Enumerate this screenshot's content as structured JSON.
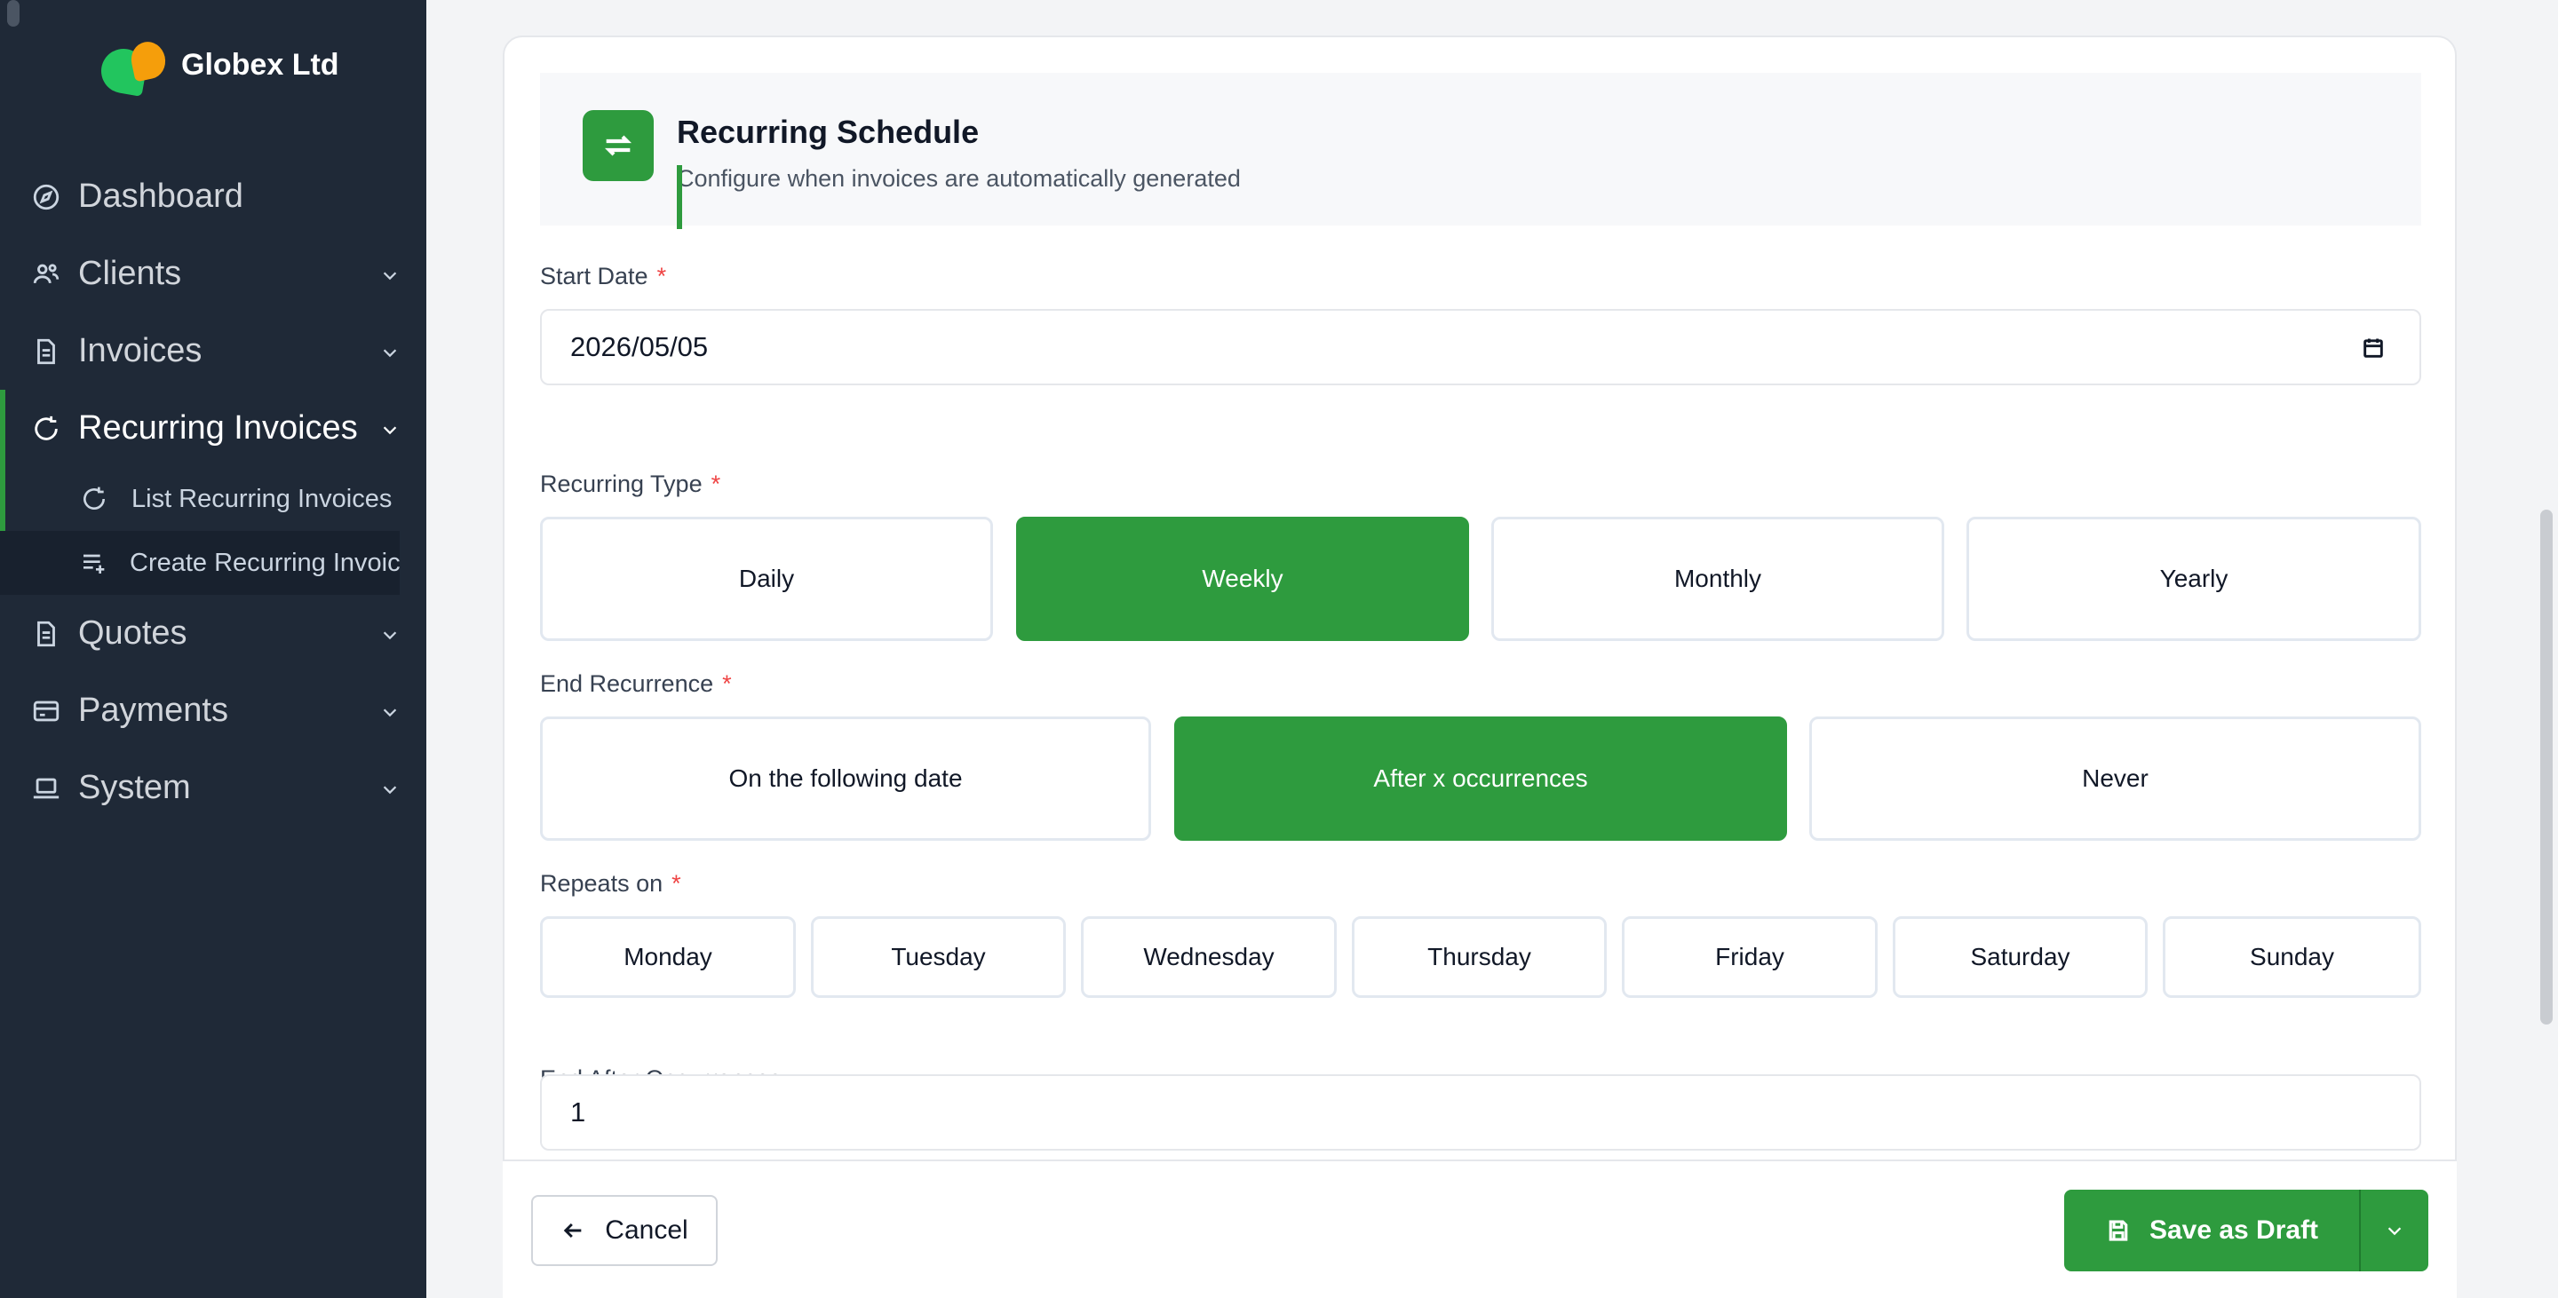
{
  "brand": {
    "name": "Globex Ltd"
  },
  "sidebar": {
    "items": [
      {
        "label": "Dashboard",
        "icon": "compass-icon"
      },
      {
        "label": "Clients",
        "icon": "users-icon"
      },
      {
        "label": "Invoices",
        "icon": "file-icon"
      },
      {
        "label": "Recurring Invoices",
        "icon": "recurring-icon"
      },
      {
        "label": "Quotes",
        "icon": "file-icon"
      },
      {
        "label": "Payments",
        "icon": "credit-card-icon"
      },
      {
        "label": "System",
        "icon": "laptop-icon"
      }
    ],
    "recurring_sub": [
      {
        "label": "List Recurring Invoices",
        "icon": "recurring-icon"
      },
      {
        "label": "Create Recurring Invoices",
        "icon": "list-add-icon"
      }
    ]
  },
  "section": {
    "title": "Recurring Schedule",
    "subtitle": "Configure when invoices are automatically generated"
  },
  "form": {
    "start_date": {
      "label": "Start Date",
      "required": "*",
      "value": "2026/05/05"
    },
    "recurring_type": {
      "label": "Recurring Type",
      "required": "*",
      "options": [
        "Daily",
        "Weekly",
        "Monthly",
        "Yearly"
      ],
      "selected": "Weekly"
    },
    "end_recurrence": {
      "label": "End Recurrence",
      "required": "*",
      "options": [
        "On the following date",
        "After x occurrences",
        "Never"
      ],
      "selected": "After x occurrences"
    },
    "repeats_on": {
      "label": "Repeats on",
      "required": "*",
      "days": [
        "Monday",
        "Tuesday",
        "Wednesday",
        "Thursday",
        "Friday",
        "Saturday",
        "Sunday"
      ]
    },
    "end_after": {
      "label": "End After Occurrences",
      "value": "1"
    }
  },
  "footer": {
    "cancel_label": "Cancel",
    "save_label": "Save as Draft"
  },
  "colors": {
    "accent": "#2e9b3e",
    "sidebar_bg": "#1f2937",
    "required": "#ef4444"
  }
}
